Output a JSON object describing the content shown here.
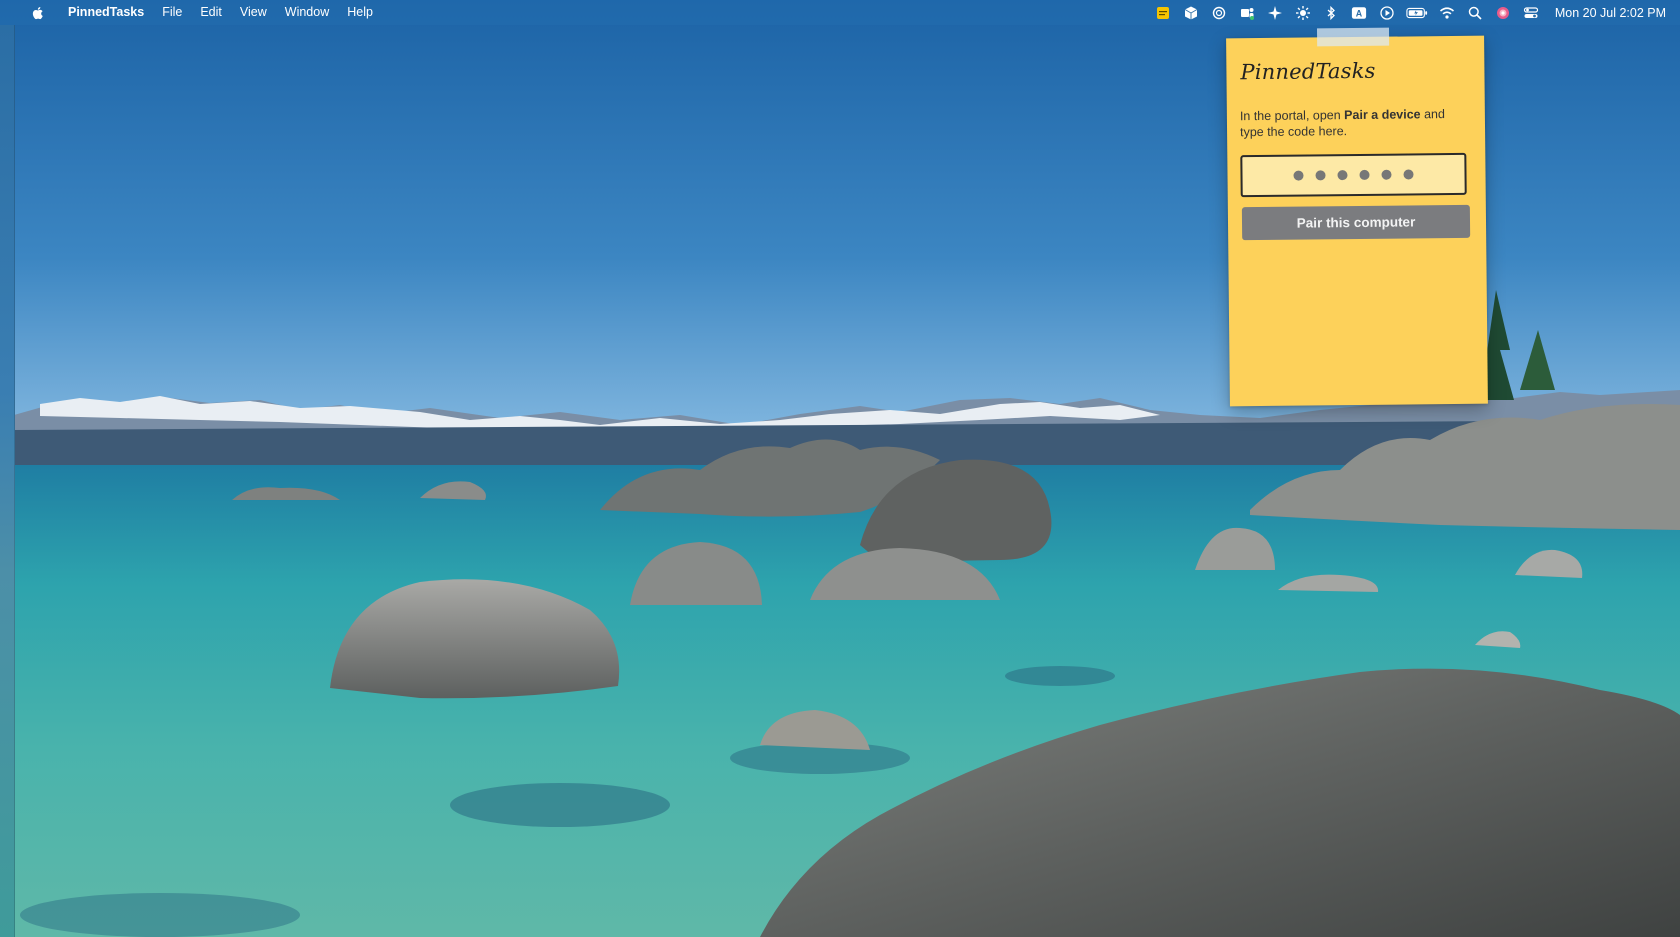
{
  "menubar": {
    "apple_icon": "apple-icon",
    "app_name": "PinnedTasks",
    "items": [
      "File",
      "Edit",
      "View",
      "Window",
      "Help"
    ],
    "status_icons": [
      "notes-icon",
      "package-icon",
      "openai-icon",
      "teams-icon",
      "sparkle-icon",
      "brightness-icon",
      "bluetooth-icon",
      "keyboard-input-icon",
      "play-icon",
      "battery-icon",
      "wifi-icon",
      "search-icon",
      "siri-icon",
      "control-center-icon"
    ],
    "keyboard_input_letter": "A",
    "clock": "Mon 20 Jul  2:02 PM"
  },
  "note": {
    "title": "PinnedTasks",
    "instructions_before": "In the portal, open ",
    "instructions_bold": "Pair a device",
    "instructions_after": " and type the code here.",
    "code_placeholder_dots": 6,
    "pair_button": "Pair this computer",
    "background_color": "#fdd15a",
    "button_color": "#7b7c7f"
  }
}
